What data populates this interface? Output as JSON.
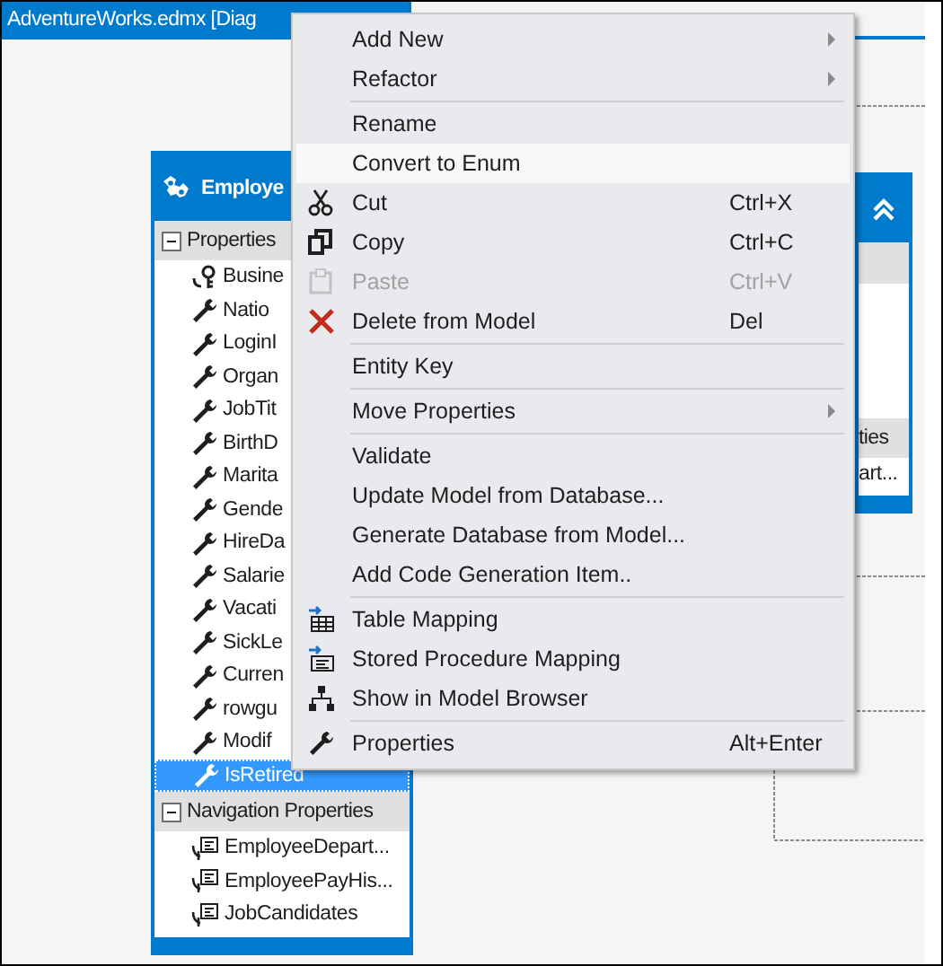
{
  "tab": {
    "title": "AdventureWorks.edmx [Diag"
  },
  "entities": [
    {
      "title": "Employe",
      "sections": [
        {
          "title": "Properties",
          "expanded": true,
          "items": [
            {
              "label": "Busine",
              "kind": "key",
              "selected": false
            },
            {
              "label": "Natio",
              "kind": "property",
              "selected": false
            },
            {
              "label": "LoginI",
              "kind": "property",
              "selected": false
            },
            {
              "label": "Organ",
              "kind": "property",
              "selected": false
            },
            {
              "label": "JobTit",
              "kind": "property",
              "selected": false
            },
            {
              "label": "BirthD",
              "kind": "property",
              "selected": false
            },
            {
              "label": "Marita",
              "kind": "property",
              "selected": false
            },
            {
              "label": "Gende",
              "kind": "property",
              "selected": false
            },
            {
              "label": "HireDa",
              "kind": "property",
              "selected": false
            },
            {
              "label": "Salarie",
              "kind": "property",
              "selected": false
            },
            {
              "label": "Vacati",
              "kind": "property",
              "selected": false
            },
            {
              "label": "SickLe",
              "kind": "property",
              "selected": false
            },
            {
              "label": "Curren",
              "kind": "property",
              "selected": false
            },
            {
              "label": "rowgu",
              "kind": "property",
              "selected": false
            },
            {
              "label": "Modif",
              "kind": "property",
              "selected": false
            },
            {
              "label": "IsRetired",
              "kind": "property",
              "selected": true
            }
          ]
        },
        {
          "title": "Navigation Properties",
          "expanded": true,
          "items": [
            {
              "label": "EmployeeDepart...",
              "kind": "navigation",
              "selected": false
            },
            {
              "label": "EmployeePayHis...",
              "kind": "navigation",
              "selected": false
            },
            {
              "label": "JobCandidates",
              "kind": "navigation",
              "selected": false
            }
          ]
        }
      ]
    },
    {
      "sections": [
        {
          "title": "ties",
          "items": [
            {
              "label": "art...",
              "kind": "plain",
              "selected": false
            }
          ]
        }
      ]
    }
  ],
  "context_menu": {
    "items": [
      {
        "kind": "item",
        "label": "Add New",
        "submenu": true,
        "disabled": false,
        "selected": false
      },
      {
        "kind": "item",
        "label": "Refactor",
        "submenu": true,
        "disabled": false,
        "selected": false
      },
      {
        "kind": "separator"
      },
      {
        "kind": "item",
        "label": "Rename",
        "submenu": false,
        "disabled": false,
        "selected": false
      },
      {
        "kind": "item",
        "label": "Convert to Enum",
        "submenu": false,
        "disabled": false,
        "selected": true
      },
      {
        "kind": "item",
        "label": "Cut",
        "shortcut": "Ctrl+X",
        "submenu": false,
        "disabled": false,
        "selected": false
      },
      {
        "kind": "item",
        "label": "Copy",
        "shortcut": "Ctrl+C",
        "submenu": false,
        "disabled": false,
        "selected": false
      },
      {
        "kind": "item",
        "label": "Paste",
        "shortcut": "Ctrl+V",
        "submenu": false,
        "disabled": true,
        "selected": false
      },
      {
        "kind": "item",
        "label": "Delete from Model",
        "shortcut": "Del",
        "submenu": false,
        "disabled": false,
        "selected": false
      },
      {
        "kind": "separator"
      },
      {
        "kind": "item",
        "label": "Entity Key",
        "submenu": false,
        "disabled": false,
        "selected": false
      },
      {
        "kind": "separator"
      },
      {
        "kind": "item",
        "label": "Move Properties",
        "submenu": true,
        "disabled": false,
        "selected": false
      },
      {
        "kind": "separator"
      },
      {
        "kind": "item",
        "label": "Validate",
        "submenu": false,
        "disabled": false,
        "selected": false
      },
      {
        "kind": "item",
        "label": "Update Model from Database...",
        "submenu": false,
        "disabled": false,
        "selected": false
      },
      {
        "kind": "item",
        "label": "Generate Database from Model...",
        "submenu": false,
        "disabled": false,
        "selected": false
      },
      {
        "kind": "item",
        "label": "Add Code Generation Item..",
        "submenu": false,
        "disabled": false,
        "selected": false
      },
      {
        "kind": "separator"
      },
      {
        "kind": "item",
        "label": "Table Mapping",
        "submenu": false,
        "disabled": false,
        "selected": false
      },
      {
        "kind": "item",
        "label": "Stored Procedure Mapping",
        "submenu": false,
        "disabled": false,
        "selected": false
      },
      {
        "kind": "item",
        "label": "Show in Model Browser",
        "submenu": false,
        "disabled": false,
        "selected": false
      },
      {
        "kind": "separator"
      },
      {
        "kind": "item",
        "label": "Properties",
        "shortcut": "Alt+Enter",
        "submenu": false,
        "disabled": false,
        "selected": false
      }
    ]
  }
}
